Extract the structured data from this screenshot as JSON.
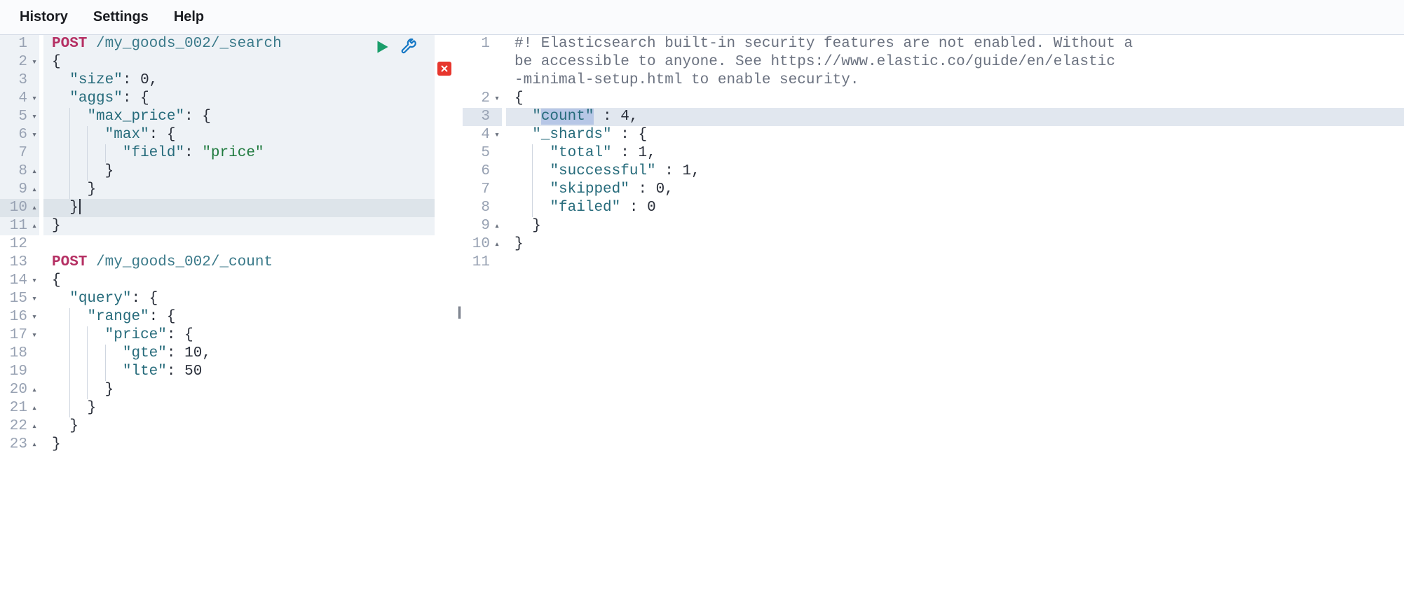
{
  "menu": {
    "history": "History",
    "settings": "Settings",
    "help": "Help"
  },
  "left": {
    "lines": [
      {
        "n": 1,
        "fold": "",
        "tokens": [
          [
            "method",
            "POST"
          ],
          [
            "plain",
            " "
          ],
          [
            "path",
            "/my_goods_002/_search"
          ]
        ]
      },
      {
        "n": 2,
        "fold": "▾",
        "tokens": [
          [
            "brace",
            "{"
          ]
        ]
      },
      {
        "n": 3,
        "fold": "",
        "indent": 1,
        "tokens": [
          [
            "key",
            "\"size\""
          ],
          [
            "colon",
            ": "
          ],
          [
            "num",
            "0"
          ],
          [
            "colon",
            ","
          ]
        ]
      },
      {
        "n": 4,
        "fold": "▾",
        "indent": 1,
        "tokens": [
          [
            "key",
            "\"aggs\""
          ],
          [
            "colon",
            ": "
          ],
          [
            "brace",
            "{"
          ]
        ]
      },
      {
        "n": 5,
        "fold": "▾",
        "indent": 2,
        "tokens": [
          [
            "key",
            "\"max_price\""
          ],
          [
            "colon",
            ": "
          ],
          [
            "brace",
            "{"
          ]
        ]
      },
      {
        "n": 6,
        "fold": "▾",
        "indent": 3,
        "tokens": [
          [
            "key",
            "\"max\""
          ],
          [
            "colon",
            ": "
          ],
          [
            "brace",
            "{"
          ]
        ]
      },
      {
        "n": 7,
        "fold": "",
        "indent": 4,
        "tokens": [
          [
            "key",
            "\"field\""
          ],
          [
            "colon",
            ": "
          ],
          [
            "str",
            "\"price\""
          ]
        ]
      },
      {
        "n": 8,
        "fold": "▴",
        "indent": 3,
        "tokens": [
          [
            "brace",
            "}"
          ]
        ]
      },
      {
        "n": 9,
        "fold": "▴",
        "indent": 2,
        "tokens": [
          [
            "brace",
            "}"
          ]
        ]
      },
      {
        "n": 10,
        "fold": "▴",
        "indent": 1,
        "tokens": [
          [
            "brace",
            "}"
          ]
        ],
        "cursor": true
      },
      {
        "n": 11,
        "fold": "▴",
        "tokens": [
          [
            "brace",
            "}"
          ]
        ]
      },
      {
        "n": 12,
        "fold": "",
        "tokens": []
      },
      {
        "n": 13,
        "fold": "",
        "tokens": [
          [
            "method",
            "POST"
          ],
          [
            "plain",
            " "
          ],
          [
            "path",
            "/my_goods_002/_count"
          ]
        ]
      },
      {
        "n": 14,
        "fold": "▾",
        "tokens": [
          [
            "brace",
            "{"
          ]
        ]
      },
      {
        "n": 15,
        "fold": "▾",
        "indent": 1,
        "tokens": [
          [
            "key",
            "\"query\""
          ],
          [
            "colon",
            ": "
          ],
          [
            "brace",
            "{"
          ]
        ]
      },
      {
        "n": 16,
        "fold": "▾",
        "indent": 2,
        "tokens": [
          [
            "key",
            "\"range\""
          ],
          [
            "colon",
            ": "
          ],
          [
            "brace",
            "{"
          ]
        ]
      },
      {
        "n": 17,
        "fold": "▾",
        "indent": 3,
        "tokens": [
          [
            "key",
            "\"price\""
          ],
          [
            "colon",
            ": "
          ],
          [
            "brace",
            "{"
          ]
        ]
      },
      {
        "n": 18,
        "fold": "",
        "indent": 4,
        "tokens": [
          [
            "key",
            "\"gte\""
          ],
          [
            "colon",
            ": "
          ],
          [
            "num",
            "10"
          ],
          [
            "colon",
            ","
          ]
        ]
      },
      {
        "n": 19,
        "fold": "",
        "indent": 4,
        "tokens": [
          [
            "key",
            "\"lte\""
          ],
          [
            "colon",
            ": "
          ],
          [
            "num",
            "50"
          ]
        ]
      },
      {
        "n": 20,
        "fold": "▴",
        "indent": 3,
        "tokens": [
          [
            "brace",
            "}"
          ]
        ]
      },
      {
        "n": 21,
        "fold": "▴",
        "indent": 2,
        "tokens": [
          [
            "brace",
            "}"
          ]
        ]
      },
      {
        "n": 22,
        "fold": "▴",
        "indent": 1,
        "tokens": [
          [
            "brace",
            "}"
          ]
        ]
      },
      {
        "n": 23,
        "fold": "▴",
        "tokens": [
          [
            "brace",
            "}"
          ]
        ]
      }
    ],
    "highlight_start": 1,
    "highlight_end": 11,
    "active_line": 10
  },
  "right": {
    "lines": [
      {
        "n": 1,
        "fold": "",
        "tokens": [
          [
            "cmt",
            "#! Elasticsearch built-in security features are not enabled. Without a"
          ]
        ]
      },
      {
        "n": "",
        "fold": "",
        "tokens": [
          [
            "cmt",
            "be accessible to anyone. See https://www.elastic.co/guide/en/elastic"
          ]
        ]
      },
      {
        "n": "",
        "fold": "",
        "tokens": [
          [
            "cmt",
            "-minimal-setup.html to enable security."
          ]
        ]
      },
      {
        "n": 2,
        "fold": "▾",
        "tokens": [
          [
            "brace",
            "{"
          ]
        ]
      },
      {
        "n": 3,
        "fold": "",
        "indent": 1,
        "tokens": [
          [
            "keysel",
            "\"count\""
          ],
          [
            "colon",
            " : "
          ],
          [
            "num",
            "4"
          ],
          [
            "colon",
            ","
          ]
        ],
        "active": true
      },
      {
        "n": 4,
        "fold": "▾",
        "indent": 1,
        "tokens": [
          [
            "key",
            "\"_shards\""
          ],
          [
            "colon",
            " : "
          ],
          [
            "brace",
            "{"
          ]
        ]
      },
      {
        "n": 5,
        "fold": "",
        "indent": 2,
        "tokens": [
          [
            "key",
            "\"total\""
          ],
          [
            "colon",
            " : "
          ],
          [
            "num",
            "1"
          ],
          [
            "colon",
            ","
          ]
        ]
      },
      {
        "n": 6,
        "fold": "",
        "indent": 2,
        "tokens": [
          [
            "key",
            "\"successful\""
          ],
          [
            "colon",
            " : "
          ],
          [
            "num",
            "1"
          ],
          [
            "colon",
            ","
          ]
        ]
      },
      {
        "n": 7,
        "fold": "",
        "indent": 2,
        "tokens": [
          [
            "key",
            "\"skipped\""
          ],
          [
            "colon",
            " : "
          ],
          [
            "num",
            "0"
          ],
          [
            "colon",
            ","
          ]
        ]
      },
      {
        "n": 8,
        "fold": "",
        "indent": 2,
        "tokens": [
          [
            "key",
            "\"failed\""
          ],
          [
            "colon",
            " : "
          ],
          [
            "num",
            "0"
          ]
        ]
      },
      {
        "n": 9,
        "fold": "▴",
        "indent": 1,
        "tokens": [
          [
            "brace",
            "}"
          ]
        ]
      },
      {
        "n": 10,
        "fold": "▴",
        "tokens": [
          [
            "brace",
            "}"
          ]
        ]
      },
      {
        "n": 11,
        "fold": "",
        "tokens": []
      }
    ]
  },
  "gutter_symbol": "||"
}
